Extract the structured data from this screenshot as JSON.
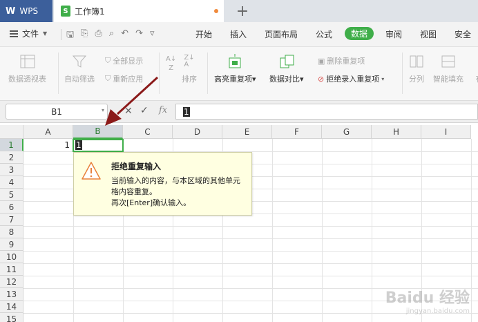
{
  "titlebar": {
    "app_label": "WPS",
    "doc_title": "工作簿1",
    "doc_icon_letter": "S",
    "new_tab": "+"
  },
  "menubar": {
    "file_label": "文件",
    "tabs": [
      "开始",
      "插入",
      "页面布局",
      "公式",
      "数据",
      "审阅",
      "视图",
      "安全"
    ],
    "active_tab": "数据"
  },
  "ribbon": {
    "pivot": "数据透视表",
    "autofilter": "自动筛选",
    "show_all": "全部显示",
    "reapply": "重新应用",
    "sort": "排序",
    "highlight_dup": "高亮重复项",
    "data_compare": "数据对比",
    "remove_dup": "删除重复项",
    "reject_dup": "拒绝录入重复项",
    "split": "分列",
    "smart_fill": "智能填充",
    "valid": "有"
  },
  "formula_bar": {
    "cell_ref": "B1",
    "fx_label": "fx",
    "value": "1"
  },
  "grid": {
    "columns": [
      "A",
      "B",
      "C",
      "D",
      "E",
      "F",
      "G",
      "H",
      "I"
    ],
    "rows": [
      "1",
      "2",
      "3",
      "4",
      "5",
      "6",
      "7",
      "8",
      "9",
      "10",
      "11",
      "12",
      "13",
      "14",
      "15"
    ],
    "a1_value": "1",
    "b1_editing": "1",
    "selected_col": "B",
    "selected_row": "1"
  },
  "tooltip": {
    "title": "拒绝重复输入",
    "line1": "当前输入的内容，与本区域的其他单元",
    "line2": "格内容重复。",
    "line3": "再次[Enter]确认输入。"
  },
  "watermark": {
    "main": "Baidu 经验",
    "sub": "jingyan.baidu.com"
  },
  "colors": {
    "accent_green": "#3fae49",
    "wps_blue": "#3c5f9b",
    "arrow_red": "#8b1a1a",
    "tooltip_bg": "#ffffe1"
  }
}
